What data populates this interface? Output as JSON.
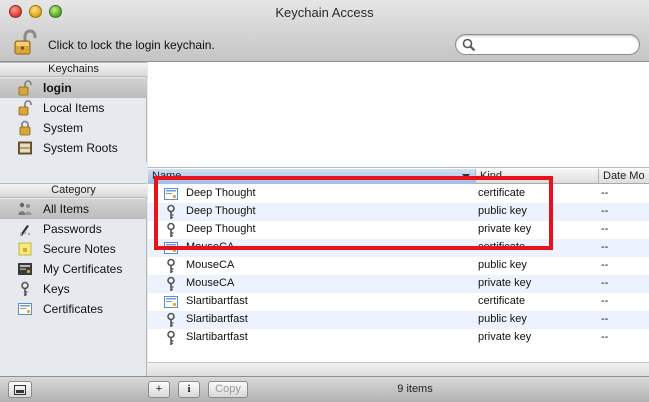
{
  "window": {
    "title": "Keychain Access"
  },
  "toolbar": {
    "lock_label": "Click to lock the login keychain.",
    "search_placeholder": "",
    "search_value": ""
  },
  "sidebar": {
    "keychains_header": "Keychains",
    "keychains": [
      {
        "label": "login",
        "icon": "open-lock-icon",
        "selected": true
      },
      {
        "label": "Local Items",
        "icon": "open-lock-icon",
        "selected": false
      },
      {
        "label": "System",
        "icon": "lock-icon",
        "selected": false
      },
      {
        "label": "System Roots",
        "icon": "certificate-cabinet-icon",
        "selected": false
      }
    ],
    "category_header": "Category",
    "categories": [
      {
        "label": "All Items",
        "icon": "all-items-icon",
        "selected": true
      },
      {
        "label": "Passwords",
        "icon": "passwords-icon",
        "selected": false
      },
      {
        "label": "Secure Notes",
        "icon": "secure-note-icon",
        "selected": false
      },
      {
        "label": "My Certificates",
        "icon": "my-certificate-icon",
        "selected": false
      },
      {
        "label": "Keys",
        "icon": "key-icon",
        "selected": false
      },
      {
        "label": "Certificates",
        "icon": "certificate-icon",
        "selected": false
      }
    ]
  },
  "table": {
    "columns": [
      {
        "label": "Name",
        "sorted": true
      },
      {
        "label": "Kind",
        "sorted": false
      },
      {
        "label": "Date Mo",
        "sorted": false
      }
    ],
    "rows": [
      {
        "name": "Deep Thought",
        "kind": "certificate",
        "date": "--",
        "icon": "certificate-icon"
      },
      {
        "name": "Deep Thought",
        "kind": "public key",
        "date": "--",
        "icon": "key-icon"
      },
      {
        "name": "Deep Thought",
        "kind": "private key",
        "date": "--",
        "icon": "key-icon"
      },
      {
        "name": "MouseCA",
        "kind": "certificate",
        "date": "--",
        "icon": "certificate-icon"
      },
      {
        "name": "MouseCA",
        "kind": "public key",
        "date": "--",
        "icon": "key-icon"
      },
      {
        "name": "MouseCA",
        "kind": "private key",
        "date": "--",
        "icon": "key-icon"
      },
      {
        "name": "Slartibartfast",
        "kind": "certificate",
        "date": "--",
        "icon": "certificate-icon"
      },
      {
        "name": "Slartibartfast",
        "kind": "public key",
        "date": "--",
        "icon": "key-icon"
      },
      {
        "name": "Slartibartfast",
        "kind": "private key",
        "date": "--",
        "icon": "key-icon"
      }
    ]
  },
  "bottom": {
    "add_label": "+",
    "info_label": "i",
    "copy_label": "Copy",
    "status": "9 items"
  },
  "colors": {
    "highlight": "#e8121a",
    "alt_row": "#edf3fe",
    "sorted_header": "#9ebde6"
  }
}
